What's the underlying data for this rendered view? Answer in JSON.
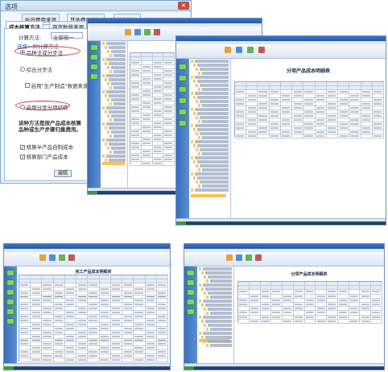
{
  "options_dialog": {
    "title": "选项",
    "close_label": "×",
    "tabs_row1": [
      "折旧费用来源",
      "其他费用来源",
      "其他选项"
    ],
    "tabs_row2": [
      "成本核算方法",
      "存货数量来源"
    ],
    "calc_method_label": "计算方法:",
    "calc_method_value": "全部统一",
    "section_label": "选择一种计算方法",
    "radio_by_product_category": "品种法或分步法",
    "radio_split_step": "综合分步法",
    "radio_cost_flow": "启用\"生产制造\"数据来源",
    "radio_step_splitting": "启用分步分项结转",
    "note_line1": "该种方法是按产品成本核算",
    "note_line2": "品种或生产步骤归集费用。",
    "check_cost_flow": "核算半产品自制成本",
    "check_cost_item": "核算部门产品成本",
    "edit_button": "编辑"
  },
  "windows": {
    "w1_doc_title": "完工产品成本明细表",
    "w2_doc_title": "分项产品成本明细表",
    "w3_doc_title": "完工产品成本明细表",
    "w4_doc_title": "分项产品成本明细表",
    "taskbar_start": "开始"
  },
  "colors": {
    "nav_blue": "#3a6fb8",
    "titlebar_blue": "#2558a4",
    "highlight_orange": "#f6c35e",
    "red_marker": "#d62a2a"
  }
}
